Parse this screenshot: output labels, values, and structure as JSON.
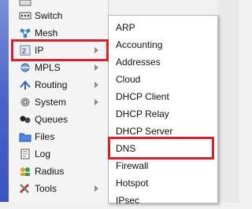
{
  "left_menu": {
    "items": [
      {
        "label": "Switch",
        "icon": "switch-icon",
        "has_submenu": false
      },
      {
        "label": "Mesh",
        "icon": "mesh-icon",
        "has_submenu": false
      },
      {
        "label": "IP",
        "icon": "ip-icon",
        "has_submenu": true
      },
      {
        "label": "MPLS",
        "icon": "mpls-icon",
        "has_submenu": true
      },
      {
        "label": "Routing",
        "icon": "routing-icon",
        "has_submenu": true
      },
      {
        "label": "System",
        "icon": "system-icon",
        "has_submenu": true
      },
      {
        "label": "Queues",
        "icon": "queues-icon",
        "has_submenu": false
      },
      {
        "label": "Files",
        "icon": "files-icon",
        "has_submenu": false
      },
      {
        "label": "Log",
        "icon": "log-icon",
        "has_submenu": false
      },
      {
        "label": "Radius",
        "icon": "radius-icon",
        "has_submenu": false
      },
      {
        "label": "Tools",
        "icon": "tools-icon",
        "has_submenu": true
      }
    ]
  },
  "submenu": {
    "items": [
      {
        "label": "ARP"
      },
      {
        "label": "Accounting"
      },
      {
        "label": "Addresses"
      },
      {
        "label": "Cloud"
      },
      {
        "label": "DHCP Client"
      },
      {
        "label": "DHCP Relay"
      },
      {
        "label": "DHCP Server"
      },
      {
        "label": "DNS"
      },
      {
        "label": "Firewall"
      },
      {
        "label": "Hotspot"
      },
      {
        "label": "IPsec"
      }
    ]
  },
  "highlights": [
    "IP",
    "DNS"
  ],
  "colors": {
    "highlight": "#d8202a",
    "sidebar_strip": "#4b63c9"
  }
}
